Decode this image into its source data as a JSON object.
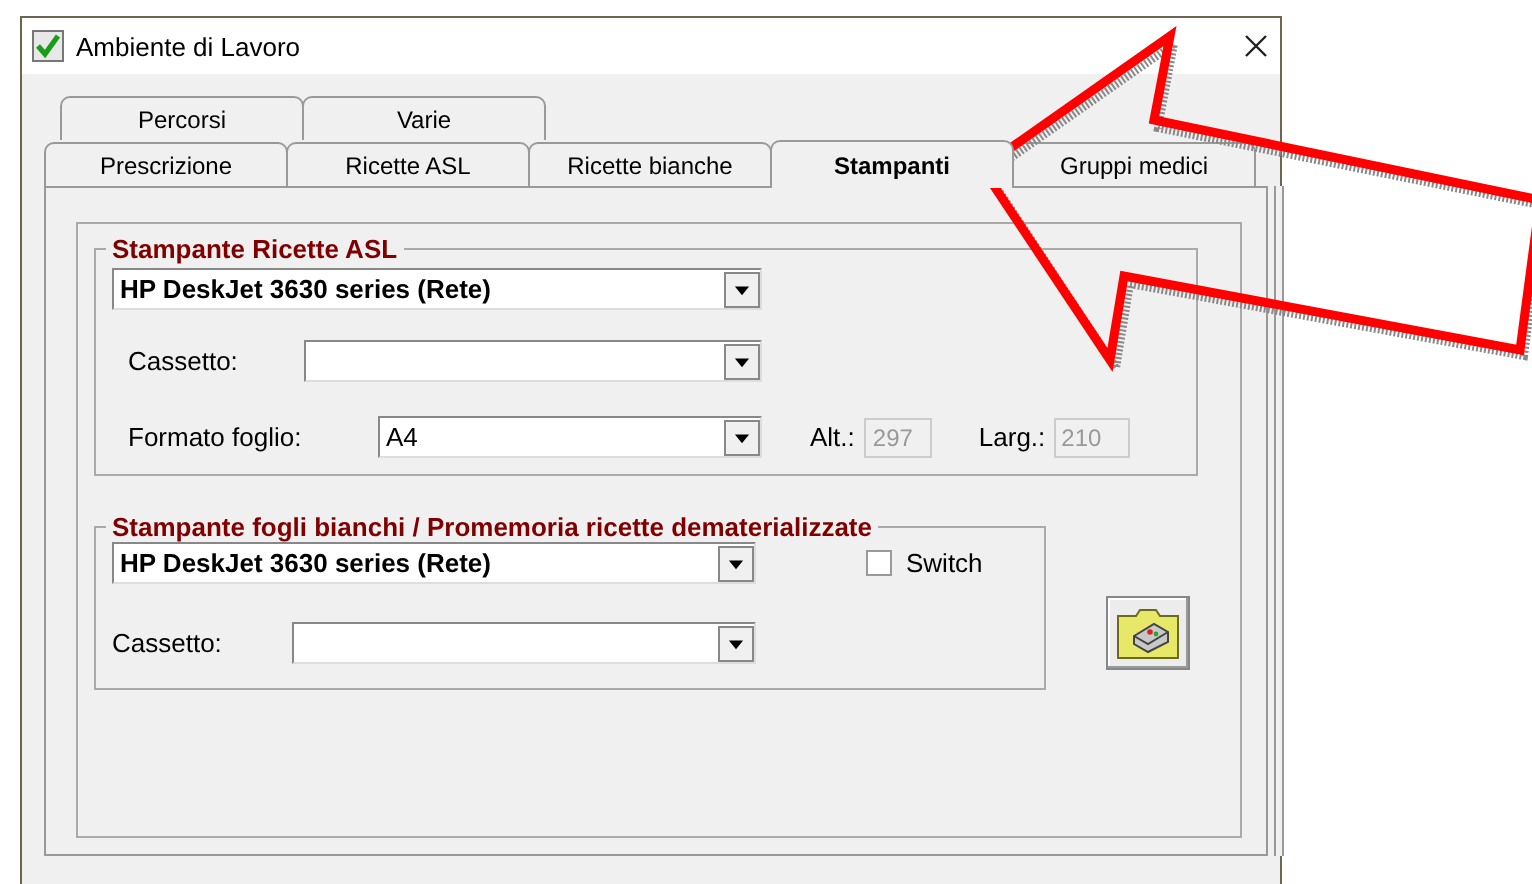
{
  "window": {
    "title": "Ambiente di Lavoro"
  },
  "tab_rows": [
    [
      {
        "label": "Percorsi",
        "selected": false
      },
      {
        "label": "Varie",
        "selected": false
      }
    ],
    [
      {
        "label": "Prescrizione",
        "selected": false
      },
      {
        "label": "Ricette ASL",
        "selected": false
      },
      {
        "label": "Ricette bianche",
        "selected": false
      },
      {
        "label": "Stampanti",
        "selected": true
      },
      {
        "label": "Gruppi medici",
        "selected": false
      }
    ]
  ],
  "asl_group": {
    "title": "Stampante Ricette ASL",
    "printer": {
      "value": "HP DeskJet 3630 series (Rete)"
    },
    "tray": {
      "label": "Cassetto:"
    },
    "paper": {
      "label": "Formato foglio:",
      "value": "A4"
    },
    "height": {
      "label": "Alt.:",
      "value": "297",
      "disabled": true
    },
    "width": {
      "label": "Larg.:",
      "value": "210",
      "disabled": true
    }
  },
  "blank_group": {
    "title": "Stampante fogli bianchi / Promemoria ricette dematerializzate",
    "printer": {
      "value": "HP DeskJet 3630 series (Rete)"
    },
    "switch": {
      "label": "Switch",
      "checked": false
    },
    "tray": {
      "label": "Cassetto:"
    }
  }
}
